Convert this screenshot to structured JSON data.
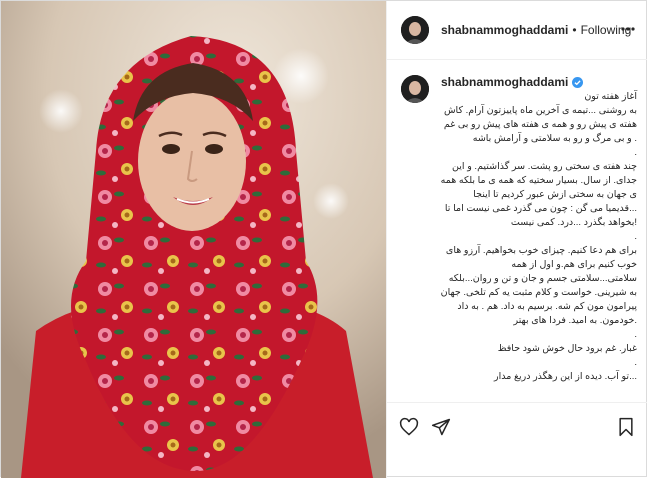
{
  "post": {
    "username": "shabnammoghaddami",
    "dot": "•",
    "follow_state": "Following",
    "caption_lines": [
      "آغاز هفته تون",
      "به روشنی ...تیمه ی آخرین ماه پاییزتون آرام. کاش",
      "هفته ی پیش رو و همه ی هفته های پیش رو بی غم",
      ". و بی مرگ و رو به سلامتی و آرامش باشه",
      ".",
      "چند هفته ی سختی رو پشت. سر گذاشتیم. و این",
      "جدای. از سال. بسیار سختیه که همه ی ما بلکه همه",
      "ی جهان به سختی ازش عبور کردیم تا اینجا",
      "...قدیمیا می گن : چون می گذرد غمی نیست اما تا",
      "!بخواهد بگذرد ...درد. کمی نیست",
      ".",
      "برای هم دعا کنیم. چیزای خوب بخواهیم. آرزو های",
      "خوب کنیم برای هم.و اول از همه",
      "سلامتی...سلامتی جسم و جان و تن و روان...بلکه",
      "به شیرینی. خواست و کلام مثبت یه کم تلخی. جهان",
      "پیرامون مون کم شه. برسیم به داد. هم . به داد",
      ".خودمون. به امید. فردا های بهتر",
      ".",
      "غبار. غم برود حال خوش شود حافظ",
      ".",
      "...تو آب. دیده از این رهگذر دریغ مدار"
    ]
  },
  "icons": {
    "more": "more-options-icon",
    "like": "heart-icon",
    "share": "share-icon",
    "save": "bookmark-icon",
    "verified": "verified-badge-icon"
  },
  "colors": {
    "verified": "#3897f0",
    "scarf": "#c2182b",
    "sweater": "#c81e2a"
  }
}
